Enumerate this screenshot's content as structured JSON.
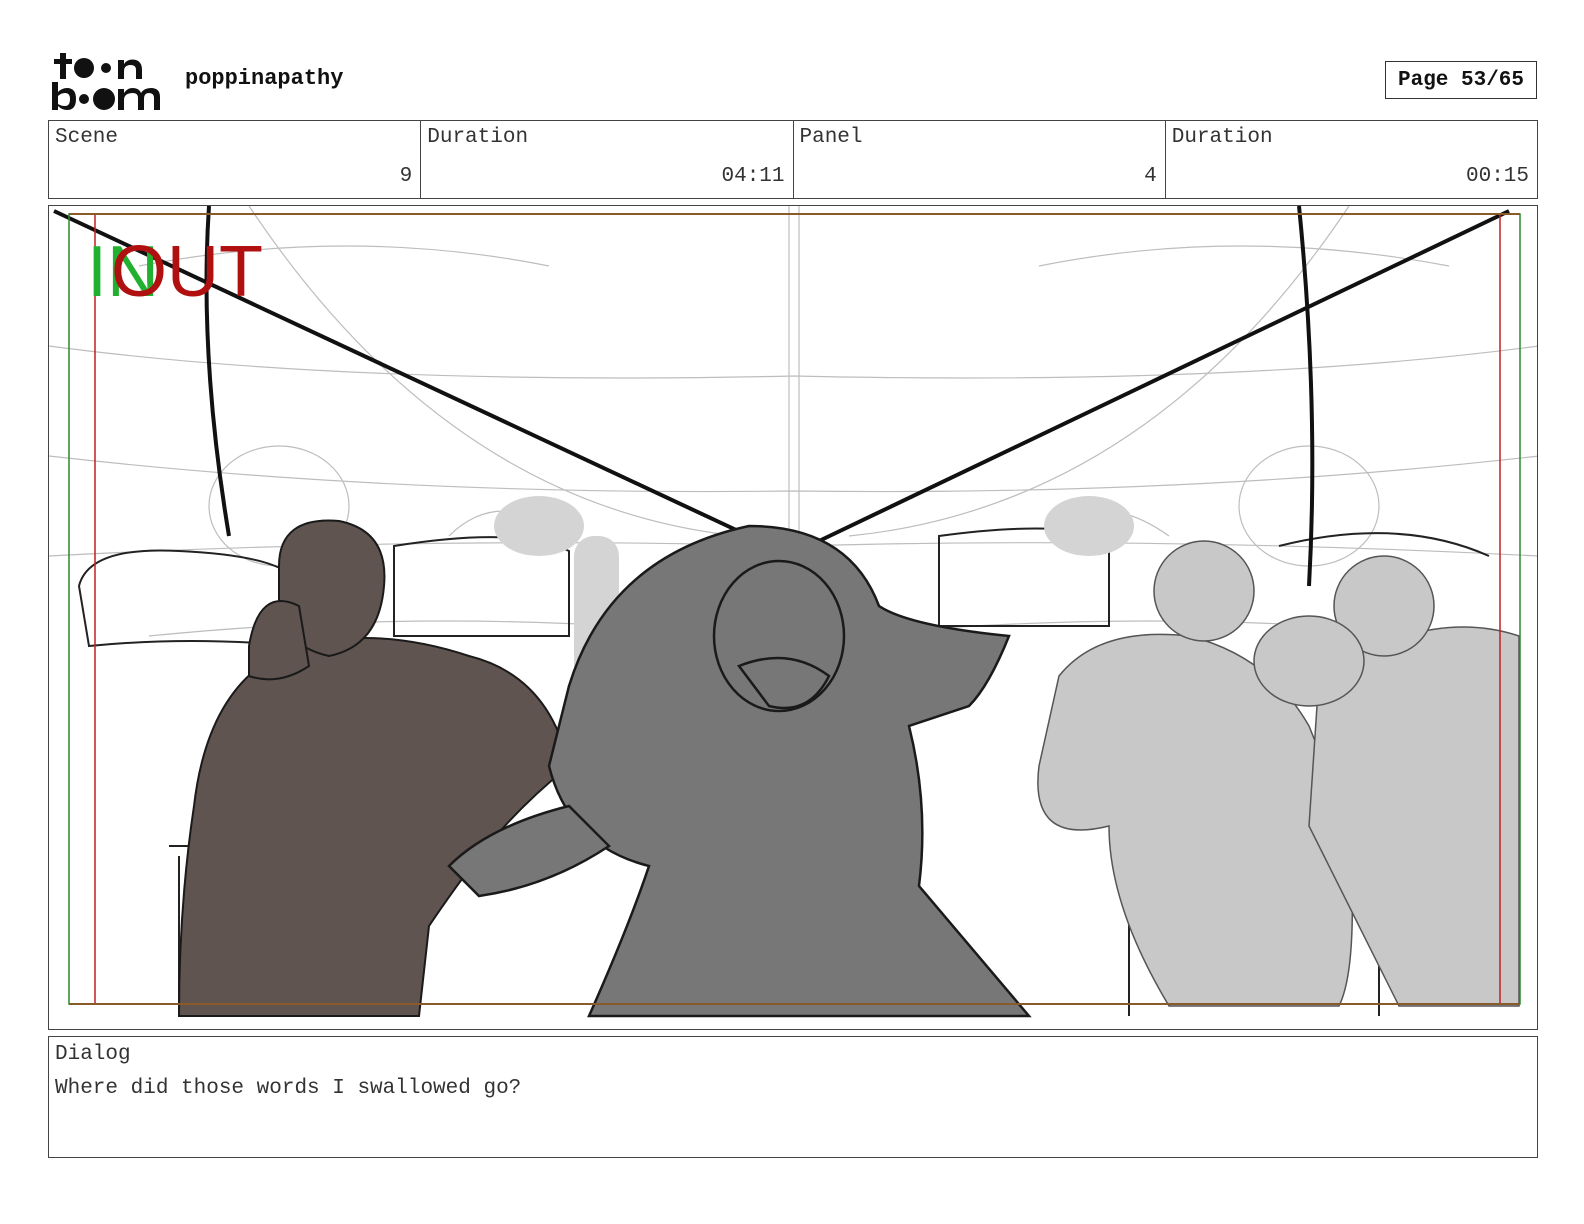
{
  "header": {
    "logo_text": "toon boom",
    "project_name": "poppinapathy",
    "page_label": "Page 53/65"
  },
  "info": {
    "scene_label": "Scene",
    "scene_value": "9",
    "scene_duration_label": "Duration",
    "scene_duration_value": "04:11",
    "panel_label": "Panel",
    "panel_value": "4",
    "panel_duration_label": "Duration",
    "panel_duration_value": "00:15"
  },
  "panel_image": {
    "in_marker": "IN",
    "out_marker": "OUT",
    "colors": {
      "in": "#22b030",
      "out": "#b01010",
      "sketch": "#222222"
    }
  },
  "dialog": {
    "label": "Dialog",
    "text": "Where did those words I swallowed go?"
  }
}
